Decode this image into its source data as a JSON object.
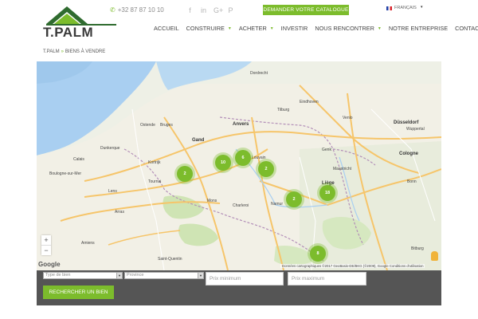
{
  "header": {
    "logo_text": "T.PALM",
    "phone": "+32 87 87 10 10",
    "socials": [
      {
        "icon": "facebook-icon",
        "glyph": "f"
      },
      {
        "icon": "linkedin-icon",
        "glyph": "in"
      },
      {
        "icon": "google-plus-icon",
        "glyph": "G+"
      },
      {
        "icon": "pinterest-icon",
        "glyph": "P"
      }
    ],
    "catalog_button": "DEMANDER VOTRE CATALOGUE",
    "language": "FRANÇAIS"
  },
  "nav": {
    "items": [
      {
        "label": "ACCUEIL",
        "has_dropdown": false
      },
      {
        "label": "CONSTRUIRE",
        "has_dropdown": true
      },
      {
        "label": "ACHETER",
        "has_dropdown": true
      },
      {
        "label": "INVESTIR",
        "has_dropdown": false
      },
      {
        "label": "NOUS RENCONTRER",
        "has_dropdown": true
      },
      {
        "label": "NOTRE ENTREPRISE",
        "has_dropdown": false
      },
      {
        "label": "CONTACT",
        "has_dropdown": false
      }
    ]
  },
  "breadcrumb": {
    "home": "T.PALM",
    "separator": "»",
    "current": "BIENS À VENDRE"
  },
  "map": {
    "zoom_in": "+",
    "zoom_out": "−",
    "google": "Google",
    "attribution": "Données cartographiques ©2017 GeoBasis-DE/BKG (©2009), Google   Conditions d'utilisation",
    "clusters": [
      {
        "count": "2"
      },
      {
        "count": "10"
      },
      {
        "count": "6"
      },
      {
        "count": "2"
      },
      {
        "count": "2"
      },
      {
        "count": "18"
      },
      {
        "count": "8"
      }
    ],
    "places": [
      {
        "name": "Dordrecht"
      },
      {
        "name": "Tilburg"
      },
      {
        "name": "Eindhoven"
      },
      {
        "name": "Venlo"
      },
      {
        "name": "Düsseldorf"
      },
      {
        "name": "Wuppertal"
      },
      {
        "name": "Bruges"
      },
      {
        "name": "Gand"
      },
      {
        "name": "Anvers"
      },
      {
        "name": "Louvain"
      },
      {
        "name": "Genk"
      },
      {
        "name": "Maastricht"
      },
      {
        "name": "Liège"
      },
      {
        "name": "Cologne"
      },
      {
        "name": "Bonn"
      },
      {
        "name": "Tournai"
      },
      {
        "name": "Mons"
      },
      {
        "name": "Charleroi"
      },
      {
        "name": "Namur"
      },
      {
        "name": "Boulogne-sur-Mer"
      },
      {
        "name": "Calais"
      },
      {
        "name": "Dunkerque"
      },
      {
        "name": "Lens"
      },
      {
        "name": "Arras"
      },
      {
        "name": "Amiens"
      },
      {
        "name": "Saint-Quentin"
      },
      {
        "name": "Bitburg"
      },
      {
        "name": "Kortrijk"
      },
      {
        "name": "Ostende"
      }
    ]
  },
  "search": {
    "type_placeholder": "Type de bien",
    "province_placeholder": "Province",
    "price_min_placeholder": "Prix minimum",
    "price_max_placeholder": "Prix maximum",
    "button": "RECHERCHER UN BIEN"
  },
  "colors": {
    "accent": "#7cbc2c",
    "search_bar": "#555555"
  }
}
